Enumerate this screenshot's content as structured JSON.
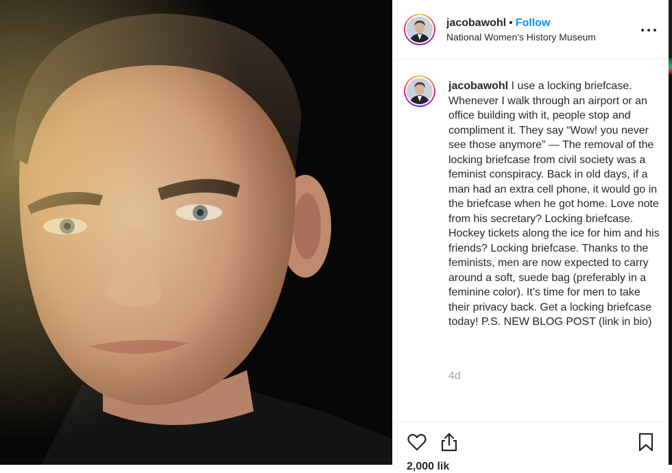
{
  "post": {
    "username": "jacobawohl",
    "separator": "•",
    "follow_label": "Follow",
    "location": "National Women's History Museum",
    "more_label": "•••",
    "caption_username": "jacobawohl",
    "caption_text": "I use a locking briefcase. Whenever I walk through an airport or an office building with it, people stop and compliment it. They say “Wow! you never see those anymore” — The removal of the locking briefcase from civil society was a feminist conspiracy. Back in old days, if a man had an extra cell phone, it would go in the briefcase when he got home. Love note from his secretary? Locking briefcase. Hockey tickets along the ice for him and his friends? Locking briefcase. Thanks to the feminists, men are now expected to carry around a soft, suede bag (preferably in a feminine color). It’s time for men to take their privacy back. Get a locking briefcase today! P.S. NEW BLOG POST (link in bio)",
    "timestamp": "4d",
    "likes_partial": "2,000 lik"
  },
  "icons": {
    "like": "heart-icon",
    "share": "share-icon",
    "save": "bookmark-icon",
    "more": "more-options-icon"
  },
  "colors": {
    "follow": "#0095f6",
    "text": "#262626",
    "muted": "#a0a0a0",
    "divider": "#efefef"
  }
}
